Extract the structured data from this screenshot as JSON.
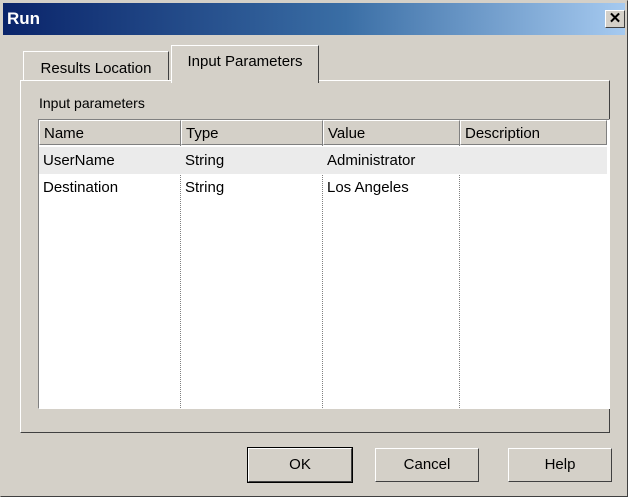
{
  "window": {
    "title": "Run"
  },
  "tabs": [
    {
      "label": "Results Location",
      "active": false
    },
    {
      "label": "Input Parameters",
      "active": true
    }
  ],
  "panel": {
    "label": "Input parameters"
  },
  "table": {
    "columns": [
      "Name",
      "Type",
      "Value",
      "Description"
    ],
    "rows": [
      {
        "name": "UserName",
        "type": "String",
        "value": "Administrator",
        "description": ""
      },
      {
        "name": "Destination",
        "type": "String",
        "value": "Los Angeles",
        "description": ""
      }
    ]
  },
  "buttons": {
    "ok": "OK",
    "cancel": "Cancel",
    "help": "Help"
  },
  "icons": {
    "close": "close-icon"
  },
  "colors": {
    "titlebar_start": "#0a246a",
    "titlebar_end": "#a6caf0",
    "face": "#d4d0c8"
  }
}
